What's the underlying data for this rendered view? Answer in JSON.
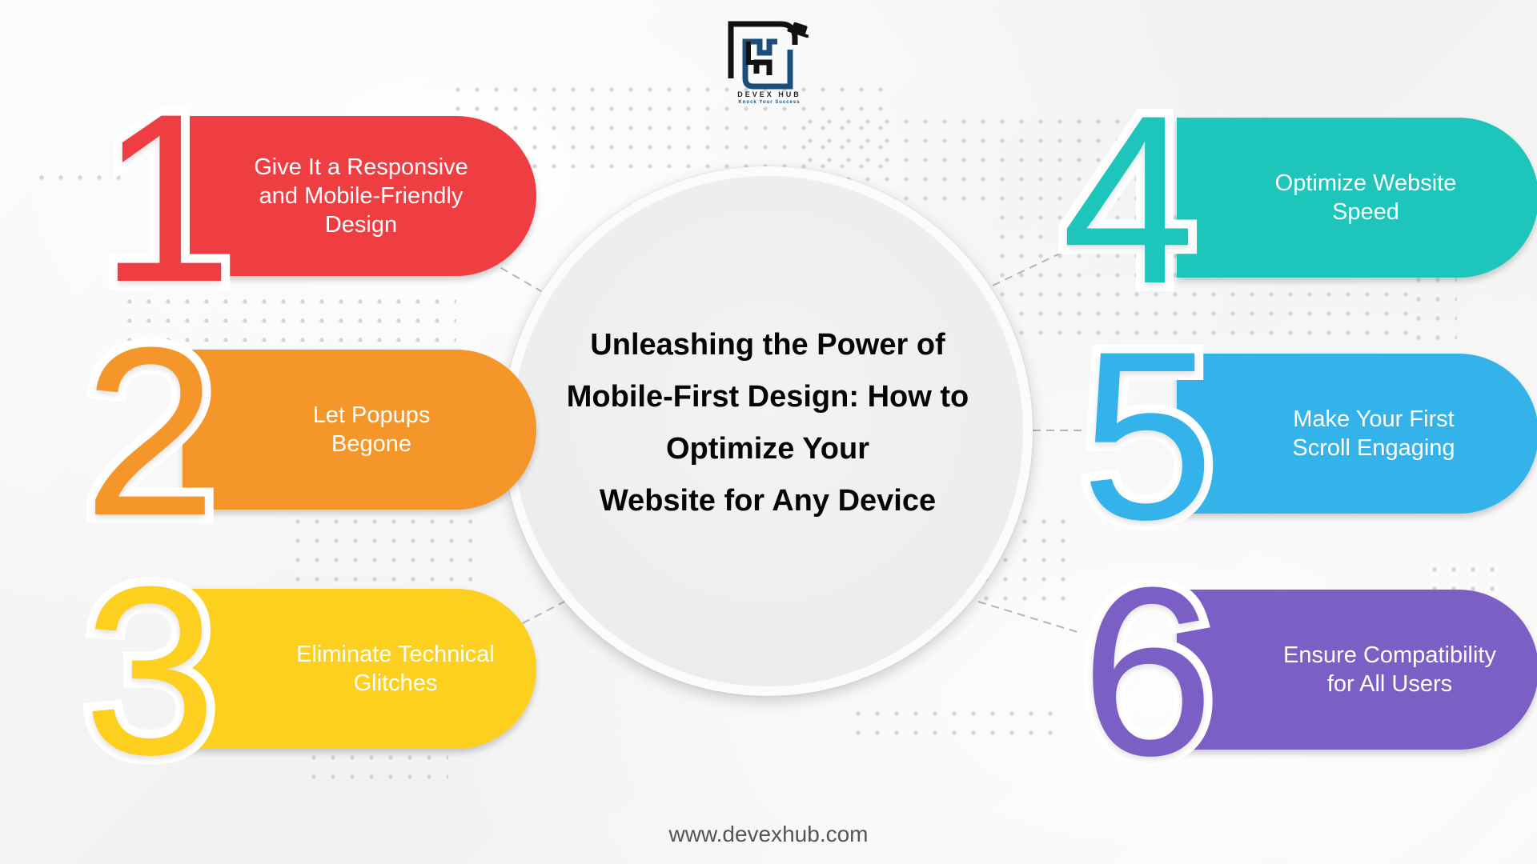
{
  "brand": {
    "name": "DEVEX HUB",
    "tagline": "Knock Your Success",
    "icon": "devex-hub-logo-icon"
  },
  "title": {
    "lines": [
      "Unleashing the Power of",
      "Mobile-First Design: How to",
      "Optimize Your",
      "Website for Any Device"
    ]
  },
  "steps": [
    {
      "number": "1",
      "lines": [
        "Give It a Responsive",
        "and Mobile-Friendly",
        "Design"
      ],
      "color": "#EF3E42"
    },
    {
      "number": "2",
      "lines": [
        "Let Popups",
        "Begone"
      ],
      "color": "#F4962A"
    },
    {
      "number": "3",
      "lines": [
        "Eliminate Technical",
        "Glitches"
      ],
      "color": "#FDD01F"
    },
    {
      "number": "4",
      "lines": [
        "Optimize Website",
        "Speed"
      ],
      "color": "#1DC5BA"
    },
    {
      "number": "5",
      "lines": [
        "Make Your First",
        "Scroll Engaging"
      ],
      "color": "#34B3EA"
    },
    {
      "number": "6",
      "lines": [
        "Ensure Compatibility",
        "for All Users"
      ],
      "color": "#7B5FC5"
    }
  ],
  "footer": {
    "url": "www.devexhub.com"
  },
  "colors": {
    "background": "#F6F6F6",
    "connector": "#B5B5B5",
    "title_text": "#050505",
    "footer_text": "#555555",
    "logo_dark": "#111111",
    "logo_blue": "#1B4F7A"
  }
}
